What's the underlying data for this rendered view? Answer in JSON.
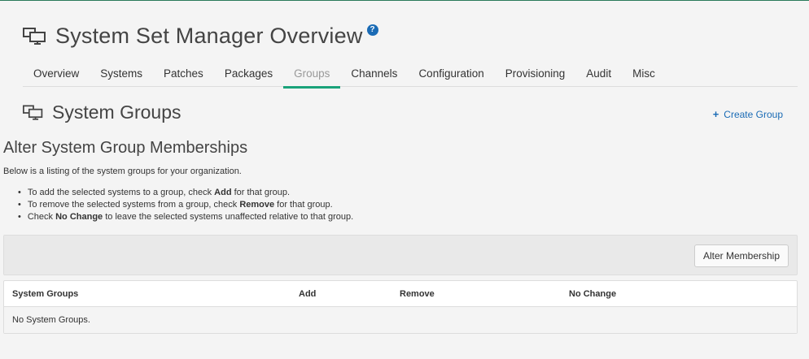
{
  "header": {
    "title": "System Set Manager Overview",
    "help": "?"
  },
  "tabs": [
    {
      "label": "Overview",
      "active": false
    },
    {
      "label": "Systems",
      "active": false
    },
    {
      "label": "Patches",
      "active": false
    },
    {
      "label": "Packages",
      "active": false
    },
    {
      "label": "Groups",
      "active": true
    },
    {
      "label": "Channels",
      "active": false
    },
    {
      "label": "Configuration",
      "active": false
    },
    {
      "label": "Provisioning",
      "active": false
    },
    {
      "label": "Audit",
      "active": false
    },
    {
      "label": "Misc",
      "active": false
    }
  ],
  "section": {
    "title": "System Groups",
    "create_label": "Create Group",
    "create_icon": "plus-icon",
    "subheading": "Alter System Group Memberships",
    "description": "Below is a listing of the system groups for your organization."
  },
  "bullets": [
    {
      "pre": "To add the selected systems to a group, check ",
      "bold": "Add",
      "post": " for that group."
    },
    {
      "pre": "To remove the selected systems from a group, check ",
      "bold": "Remove",
      "post": " for that group."
    },
    {
      "pre": "Check ",
      "bold": "No Change",
      "post": " to leave the selected systems unaffected relative to that group."
    }
  ],
  "action": {
    "alter_label": "Alter Membership"
  },
  "table": {
    "columns": [
      "System Groups",
      "Add",
      "Remove",
      "No Change"
    ],
    "empty_message": "No System Groups."
  },
  "colors": {
    "accent": "#1aa37a",
    "link": "#1a6bb5"
  }
}
